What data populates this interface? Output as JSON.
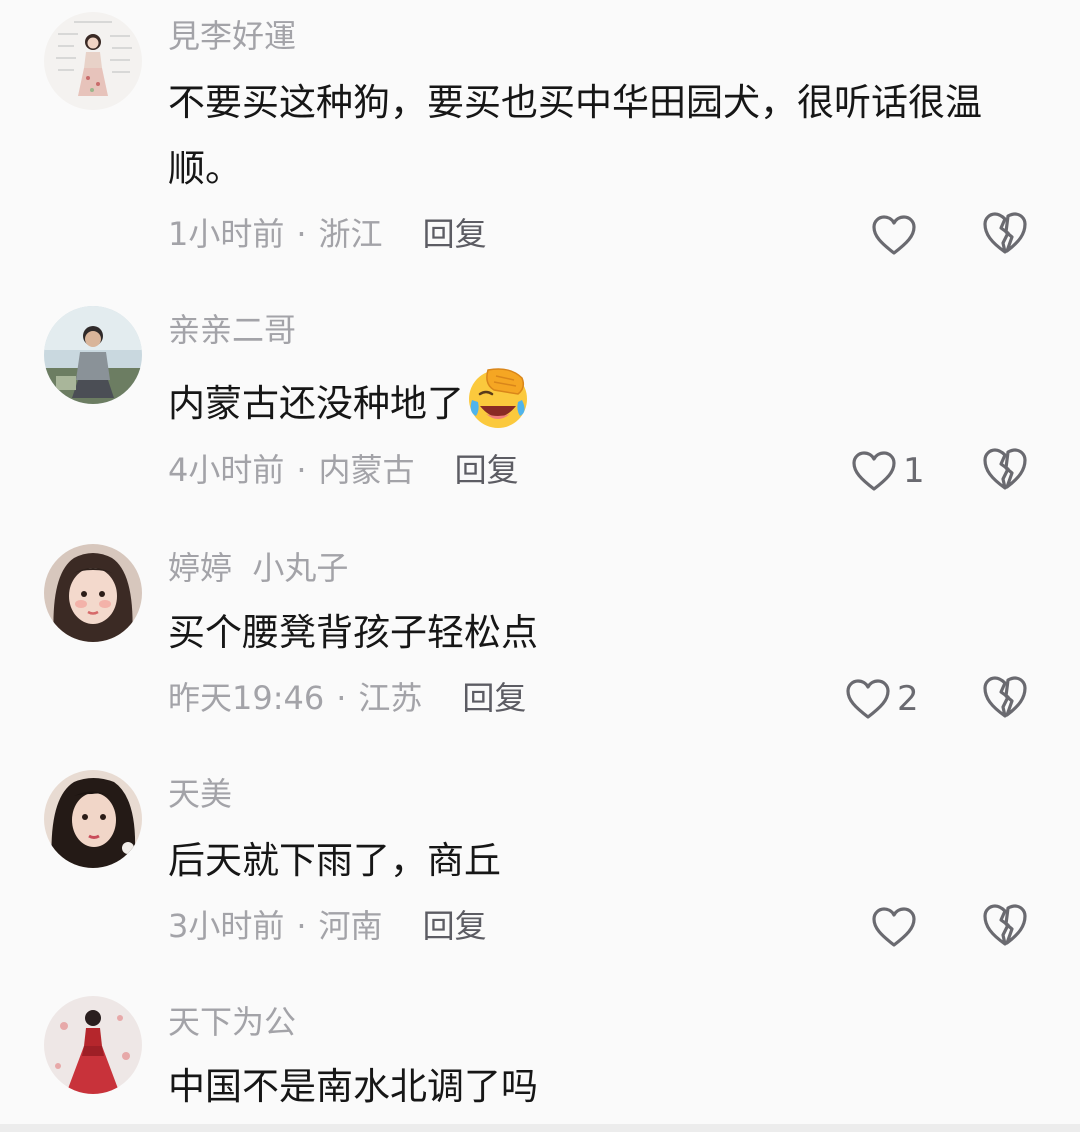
{
  "comments": [
    {
      "username": "見李好運",
      "text": "不要买这种狗，要买也买中华田园犬，很听话很温顺。",
      "time": "1小时前",
      "location": "浙江",
      "reply_label": "回复",
      "likes": ""
    },
    {
      "username": "亲亲二哥",
      "text": "内蒙古还没种地了",
      "emoji": "facepalm-laughing-emoji",
      "time": "4小时前",
      "location": "内蒙古",
      "reply_label": "回复",
      "likes": "1"
    },
    {
      "username": "婷婷  小丸子",
      "text": "买个腰凳背孩子轻松点",
      "time": "昨天19:46",
      "location": "江苏",
      "reply_label": "回复",
      "likes": "2"
    },
    {
      "username": "天美",
      "text": "后天就下雨了，商丘",
      "time": "3小时前",
      "location": "河南",
      "reply_label": "回复",
      "likes": ""
    },
    {
      "username": "天下为公",
      "text": "中国不是南水北调了吗"
    }
  ],
  "separator": "·",
  "icons": {
    "like": "heart-outline-icon",
    "dislike": "broken-heart-icon"
  },
  "colors": {
    "background": "#fafafa",
    "text": "#161616",
    "secondary": "#a3a3a8",
    "icon": "#6a6a70"
  }
}
